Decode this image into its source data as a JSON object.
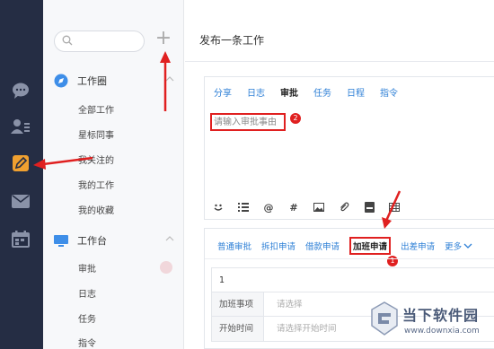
{
  "sidebar_rail": {
    "icons": [
      "chat-icon",
      "contacts-icon",
      "work-edit-icon",
      "mail-icon",
      "calendar-icon"
    ]
  },
  "nav": {
    "search": {
      "placeholder": ""
    },
    "add_symbol": "+",
    "section1": {
      "title": "工作圈",
      "items": [
        "全部工作",
        "星标同事",
        "我关注的",
        "我的工作",
        "我的收藏"
      ]
    },
    "section2": {
      "title": "工作台",
      "items": [
        "审批",
        "日志",
        "任务",
        "指令"
      ]
    }
  },
  "main": {
    "title": "发布一条工作",
    "tabs": [
      "分享",
      "日志",
      "审批",
      "任务",
      "日程",
      "指令"
    ],
    "active_tab": "审批",
    "reason_placeholder": "请输入审批事由",
    "toolbar": {
      "at_symbol": "@",
      "hash_symbol": "#"
    },
    "approval_types": [
      "普通审批",
      "拆扣申请",
      "借款申请",
      "加班申请",
      "出差申请"
    ],
    "active_type": "加班申请",
    "more_label": "更多",
    "form": {
      "row_number": "1",
      "rows": [
        {
          "label": "加班事项",
          "placeholder": "请选择"
        },
        {
          "label": "开始时间",
          "placeholder": "请选择开始时间"
        }
      ]
    }
  },
  "annotations": {
    "marker1": "1",
    "marker2": "2",
    "color": "#e02020"
  },
  "watermark": {
    "text": "当下软件园",
    "url": "www.downxia.com"
  },
  "colors": {
    "rail_bg": "#252d44",
    "rail_active": "#f0a030",
    "link_blue": "#2d7fd6",
    "annotation_red": "#e02020"
  }
}
